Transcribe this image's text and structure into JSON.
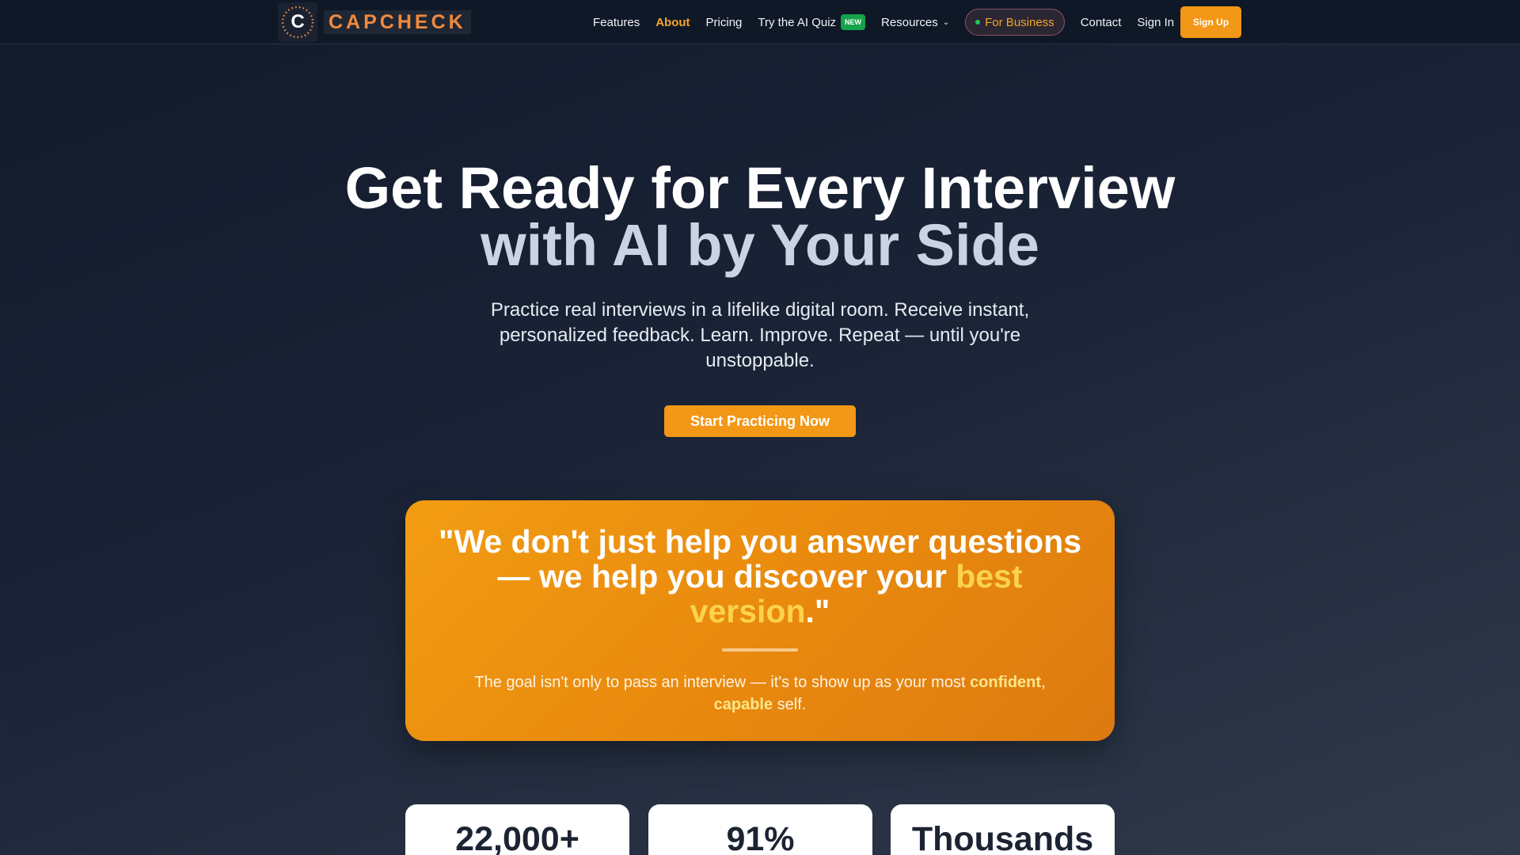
{
  "nav": {
    "logo_letter": "C",
    "logo_text": "CAPCHECK",
    "links": {
      "features": "Features",
      "about": "About",
      "pricing": "Pricing",
      "ai_quiz": "Try the AI Quiz",
      "ai_quiz_badge": "NEW",
      "resources": "Resources",
      "for_business": "For Business",
      "contact": "Contact",
      "sign_in": "Sign In"
    },
    "sign_up": "Sign Up",
    "active_link": "About"
  },
  "hero": {
    "title_line1": "Get Ready for Every Interview",
    "title_line2": "with AI by Your Side",
    "subtitle": "Practice real interviews in a lifelike digital room. Receive instant, personalized feedback. Learn. Improve. Repeat — until you're unstoppable.",
    "cta": "Start Practicing Now"
  },
  "quote": {
    "text_before": "\"We don't just help you answer questions — we help you discover your ",
    "text_highlight": "best version",
    "text_after": ".\"",
    "sub_before": "The goal isn't only to pass an interview — it's to show up as your most ",
    "sub_hl1": "confident",
    "sub_mid": ", ",
    "sub_hl2": "capable",
    "sub_after": " self."
  },
  "stats": [
    {
      "value": "22,000+"
    },
    {
      "value": "91%"
    },
    {
      "value": "Thousands"
    }
  ],
  "colors": {
    "accent": "#f29716",
    "active_link": "#f5a524",
    "highlight": "#fcd34d",
    "new_badge": "#16a34a"
  }
}
